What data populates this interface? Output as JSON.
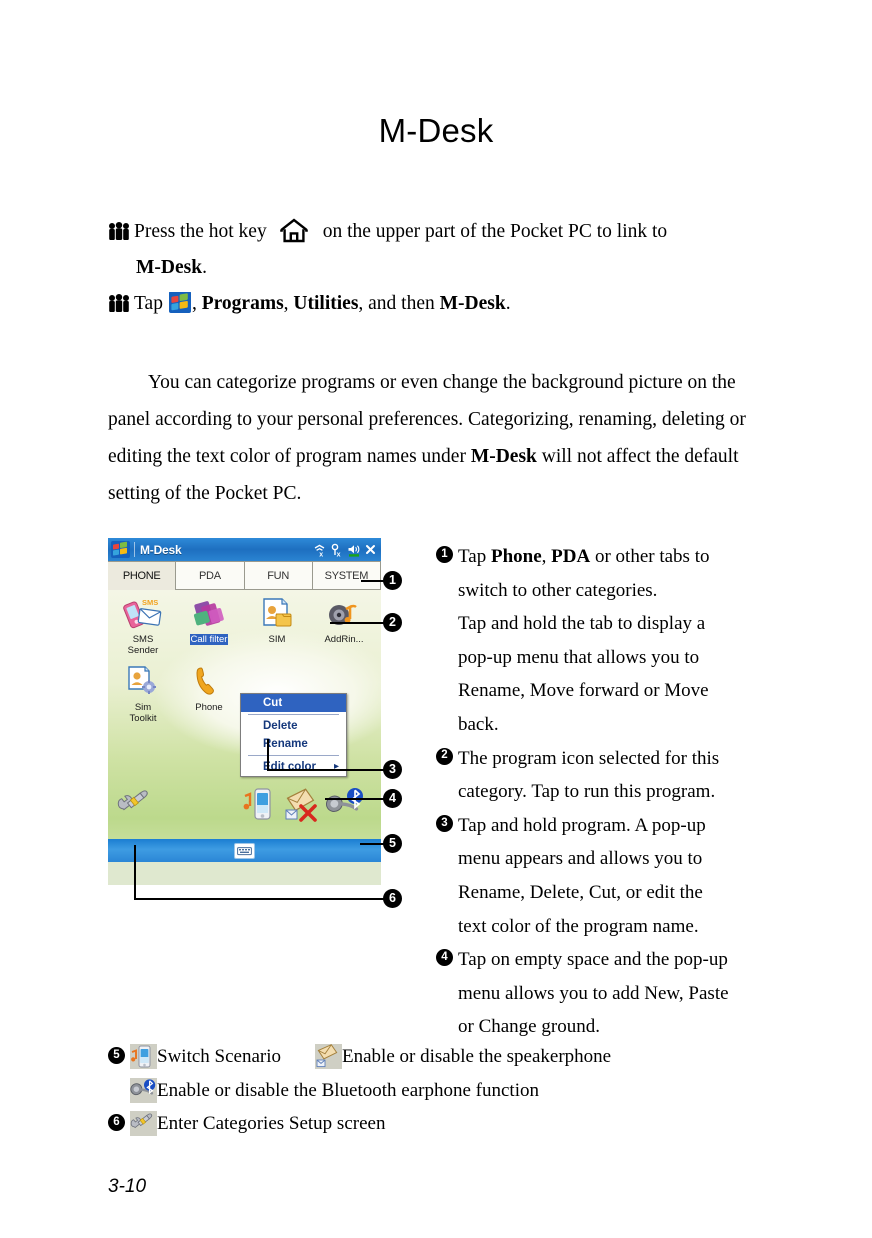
{
  "document": {
    "title": "M-Desk",
    "page_number": "3-10"
  },
  "bullets": [
    {
      "icon": "people-icon",
      "text_before": "Press the hot key",
      "inline_icon": "home-icon",
      "text_after": "on the upper part of the Pocket PC to link to",
      "continuation_bold": "M-Desk",
      "continuation_tail": "."
    },
    {
      "icon": "people-icon",
      "text_before": "Tap",
      "inline_icon": "windows-start-icon",
      "seq_1": ",",
      "bold_1": "Programs",
      "seq_2": ",",
      "bold_2": "Utilities",
      "seq_3": ", and then",
      "bold_3": "M-Desk",
      "seq_4": "."
    }
  ],
  "paragraph": {
    "part1": "You can categorize programs or even change the background picture on the panel according to your personal preferences. Categorizing, renaming, deleting or editing the text color of program names under ",
    "bold": "M-Desk",
    "part2": " will not affect the default setting of the Pocket PC."
  },
  "pda": {
    "titlebar": {
      "app_title": "M-Desk",
      "start_icon": "windows-start-icon",
      "status_icons": [
        "connectivity-off-icon",
        "signal-off-icon",
        "volume-icon",
        "close-icon"
      ]
    },
    "tabs": [
      {
        "label": "PHONE",
        "active": true
      },
      {
        "label": "PDA",
        "active": false
      },
      {
        "label": "FUN",
        "active": false
      },
      {
        "label": "SYSTEM",
        "active": false
      }
    ],
    "programs": [
      {
        "label": "SMS\nSender",
        "icon": "sms-sender-icon",
        "selected": false
      },
      {
        "label": "Call filter",
        "icon": "call-filter-icon",
        "selected": true
      },
      {
        "label": "SIM",
        "icon": "sim-manager-icon",
        "selected": false
      },
      {
        "label": "AddRin...",
        "icon": "add-ringtone-icon",
        "selected": false
      },
      {
        "label": "Sim\nToolkit",
        "icon": "sim-toolkit-icon",
        "selected": false
      },
      {
        "label": "Phone",
        "icon": "phone-icon",
        "selected": false
      }
    ],
    "context_menu": {
      "items": [
        {
          "label": "Cut",
          "highlighted": true,
          "submenu": false
        },
        {
          "label": "Delete",
          "highlighted": false,
          "submenu": false
        },
        {
          "label": "Rename",
          "highlighted": false,
          "submenu": false
        },
        {
          "label": "Edit color",
          "highlighted": false,
          "submenu": true
        }
      ],
      "submenu_arrow": "▸"
    },
    "tray": [
      {
        "icon": "categories-setup-icon"
      },
      {
        "icon": "switch-scenario-icon"
      },
      {
        "icon": "speakerphone-icon"
      },
      {
        "icon": "bluetooth-earphone-icon"
      }
    ],
    "taskbar": {
      "sip_icon": "keyboard-icon"
    }
  },
  "callouts": [
    "❶",
    "❷",
    "❸",
    "❹",
    "❺",
    "❻"
  ],
  "callout_numbers": [
    "1",
    "2",
    "3",
    "4",
    "5",
    "6"
  ],
  "notes": [
    {
      "number": "1",
      "lines": [
        {
          "type": "mixed",
          "pre": "Tap ",
          "b1": "Phone",
          "mid": ", ",
          "b2": "PDA",
          "post": " or other tabs to"
        },
        {
          "type": "plain",
          "text": "switch to other categories."
        },
        {
          "type": "plain",
          "text": "Tap and hold the tab to display a"
        },
        {
          "type": "plain",
          "text": "pop-up menu that allows you to"
        },
        {
          "type": "plain",
          "text": "Rename, Move forward or Move"
        },
        {
          "type": "plain",
          "text": "back."
        }
      ]
    },
    {
      "number": "2",
      "lines": [
        {
          "type": "plain",
          "text": "The program icon selected for this"
        },
        {
          "type": "plain",
          "text": "category. Tap to run this program."
        }
      ]
    },
    {
      "number": "3",
      "lines": [
        {
          "type": "plain",
          "text": "Tap and hold program. A pop-up"
        },
        {
          "type": "plain",
          "text": "menu appears and allows you to"
        },
        {
          "type": "plain",
          "text": "Rename, Delete, Cut, or edit the"
        },
        {
          "type": "plain",
          "text": "text color of the program name."
        }
      ]
    },
    {
      "number": "4",
      "lines": [
        {
          "type": "plain",
          "text": "Tap on empty space and the pop-up"
        },
        {
          "type": "plain",
          "text": "menu allows you to add New, Paste"
        },
        {
          "type": "plain",
          "text": "or Change ground."
        }
      ]
    }
  ],
  "legend": [
    {
      "number": "5",
      "entries": [
        {
          "icon": "switch-scenario-icon",
          "text": "Switch Scenario"
        },
        {
          "icon": "speakerphone-icon",
          "text": "Enable or disable the speakerphone"
        }
      ]
    },
    {
      "number": "",
      "entries": [
        {
          "icon": "bluetooth-earphone-icon",
          "text": "Enable or disable the Bluetooth earphone function"
        }
      ]
    },
    {
      "number": "6",
      "entries": [
        {
          "icon": "categories-setup-icon",
          "text": "Enter Categories Setup screen"
        }
      ]
    }
  ],
  "colors": {
    "titlebar_blue": "#1e6fc0",
    "taskbar_blue": "#2b86d6",
    "selection_blue": "#2f63c0",
    "menu_text": "#15387c",
    "desktop_green": "#cfe2a4",
    "page_background": "#ffffff"
  }
}
